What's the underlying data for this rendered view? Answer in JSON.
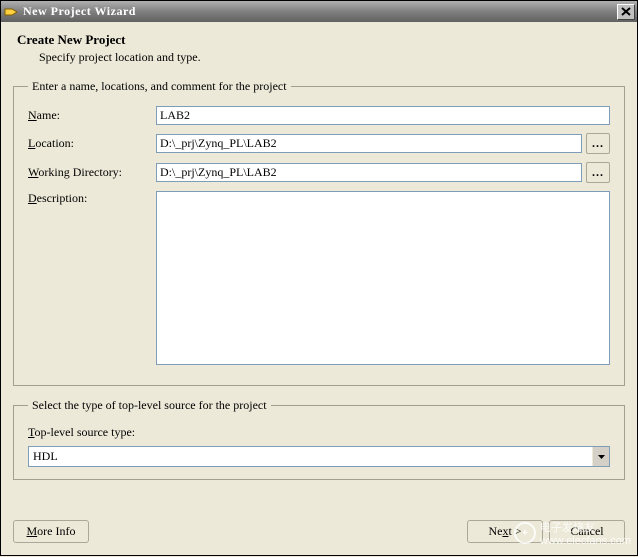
{
  "window": {
    "title": "New Project Wizard"
  },
  "header": {
    "title": "Create New Project",
    "subtitle": "Specify project location and type."
  },
  "group1": {
    "legend": "Enter a name, locations, and comment for the project",
    "name_label": "Name:",
    "name_value": "LAB2",
    "location_label": "Location:",
    "location_value": "D:\\_prj\\Zynq_PL\\LAB2",
    "workdir_label": "Working Directory:",
    "workdir_value": "D:\\_prj\\Zynq_PL\\LAB2",
    "description_label": "Description:",
    "description_value": "",
    "browse_label": "..."
  },
  "group2": {
    "legend": "Select the type of top-level source for the project",
    "label": "Top-level source type:",
    "value": "HDL"
  },
  "buttons": {
    "more_info": "More Info",
    "next": "Next >",
    "cancel": "Cancel"
  },
  "watermark": {
    "text_cn": "电子发烧友",
    "text_en": "www.elecfans.com"
  },
  "accel": {
    "name": "N",
    "location": "L",
    "workdir": "W",
    "description": "D",
    "toplevel": "T",
    "moreinfo": "M",
    "next": "N"
  }
}
